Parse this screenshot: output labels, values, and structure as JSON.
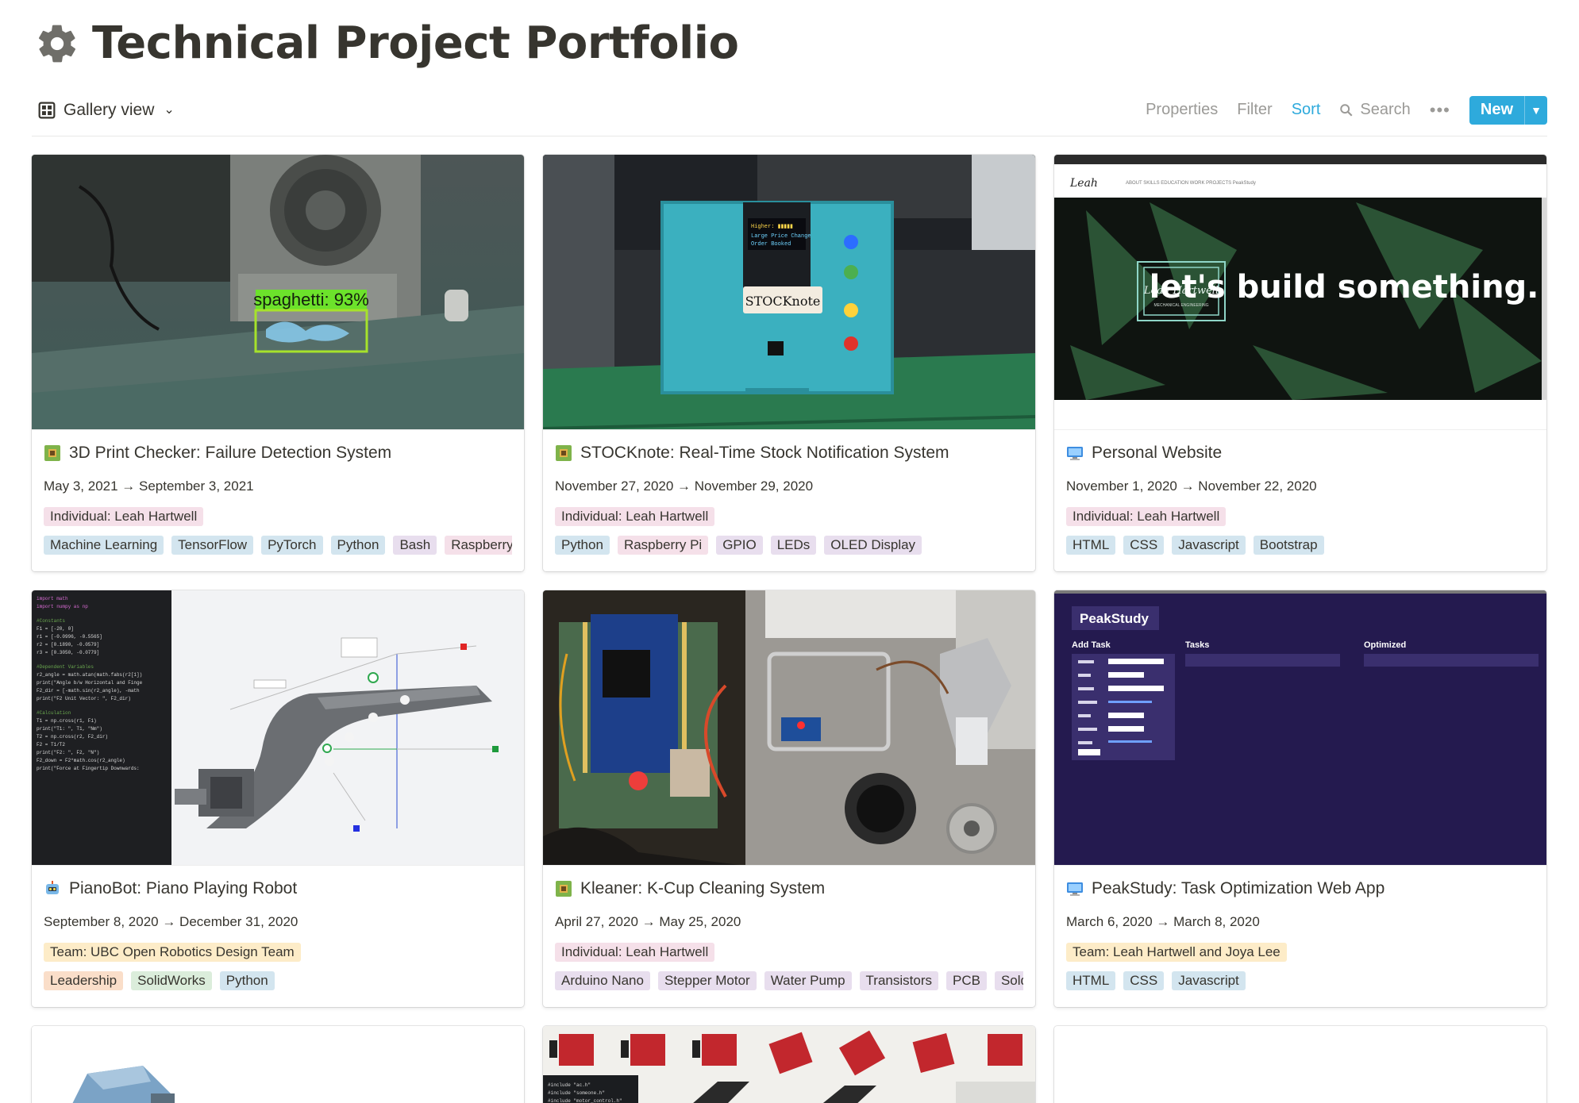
{
  "page": {
    "title": "Technical Project Portfolio"
  },
  "toolbar": {
    "view_label": "Gallery view",
    "properties": "Properties",
    "filter": "Filter",
    "sort": "Sort",
    "search": "Search",
    "more": "•••",
    "new_label": "New"
  },
  "colors": {
    "accent": "#2eaadc",
    "text": "#37352f",
    "muted": "#9b9a97"
  },
  "cards": [
    {
      "title": "3D Print Checker: Failure Detection System",
      "icon": "circuit-board-icon",
      "dates": "May 3, 2021 → September 3, 2021",
      "team": "Individual: Leah Hartwell",
      "tags": [
        "Machine Learning",
        "TensorFlow",
        "PyTorch",
        "Python",
        "Bash",
        "Raspberry Pi"
      ],
      "cover_label": "spaghetti: 93%"
    },
    {
      "title": "STOCKnote: Real-Time Stock Notification System",
      "icon": "circuit-board-icon",
      "dates": "November 27, 2020 → November 29, 2020",
      "team": "Individual: Leah Hartwell",
      "tags": [
        "Python",
        "Raspberry Pi",
        "GPIO",
        "LEDs",
        "OLED Display"
      ],
      "cover_label": "STOCKnote"
    },
    {
      "title": "Personal Website",
      "icon": "computer-icon",
      "dates": "November 1, 2020 → November 22, 2020",
      "team": "Individual: Leah Hartwell",
      "tags": [
        "HTML",
        "CSS",
        "Javascript",
        "Bootstrap"
      ],
      "cover_label": "let's build something.",
      "cover_nav": "ABOUT   SKILLS   EDUCATION   WORK   PROJECTS   PeakStudy",
      "cover_logo_sub": "MECHANICAL ENGINEERING"
    },
    {
      "title": "PianoBot: Piano Playing Robot",
      "icon": "robot-icon",
      "dates": "September 8, 2020 → December 31, 2020",
      "team": "Team: UBC Open Robotics Design Team",
      "tags": [
        "Leadership",
        "SolidWorks",
        "Python"
      ]
    },
    {
      "title": "Kleaner: K-Cup Cleaning System",
      "icon": "circuit-board-icon",
      "dates": "April 27, 2020 → May 25, 2020",
      "team": "Individual: Leah Hartwell",
      "tags": [
        "Arduino Nano",
        "Stepper Motor",
        "Water Pump",
        "Transistors",
        "PCB",
        "Soldering"
      ]
    },
    {
      "title": "PeakStudy: Task Optimization Web App",
      "icon": "computer-icon",
      "dates": "March 6, 2020 → March 8, 2020",
      "team": "Team: Leah Hartwell and Joya Lee",
      "tags": [
        "HTML",
        "CSS",
        "Javascript"
      ],
      "cover_app_name": "PeakStudy",
      "cover_sections": [
        "Add Task",
        "Tasks",
        "Optimized"
      ]
    }
  ]
}
